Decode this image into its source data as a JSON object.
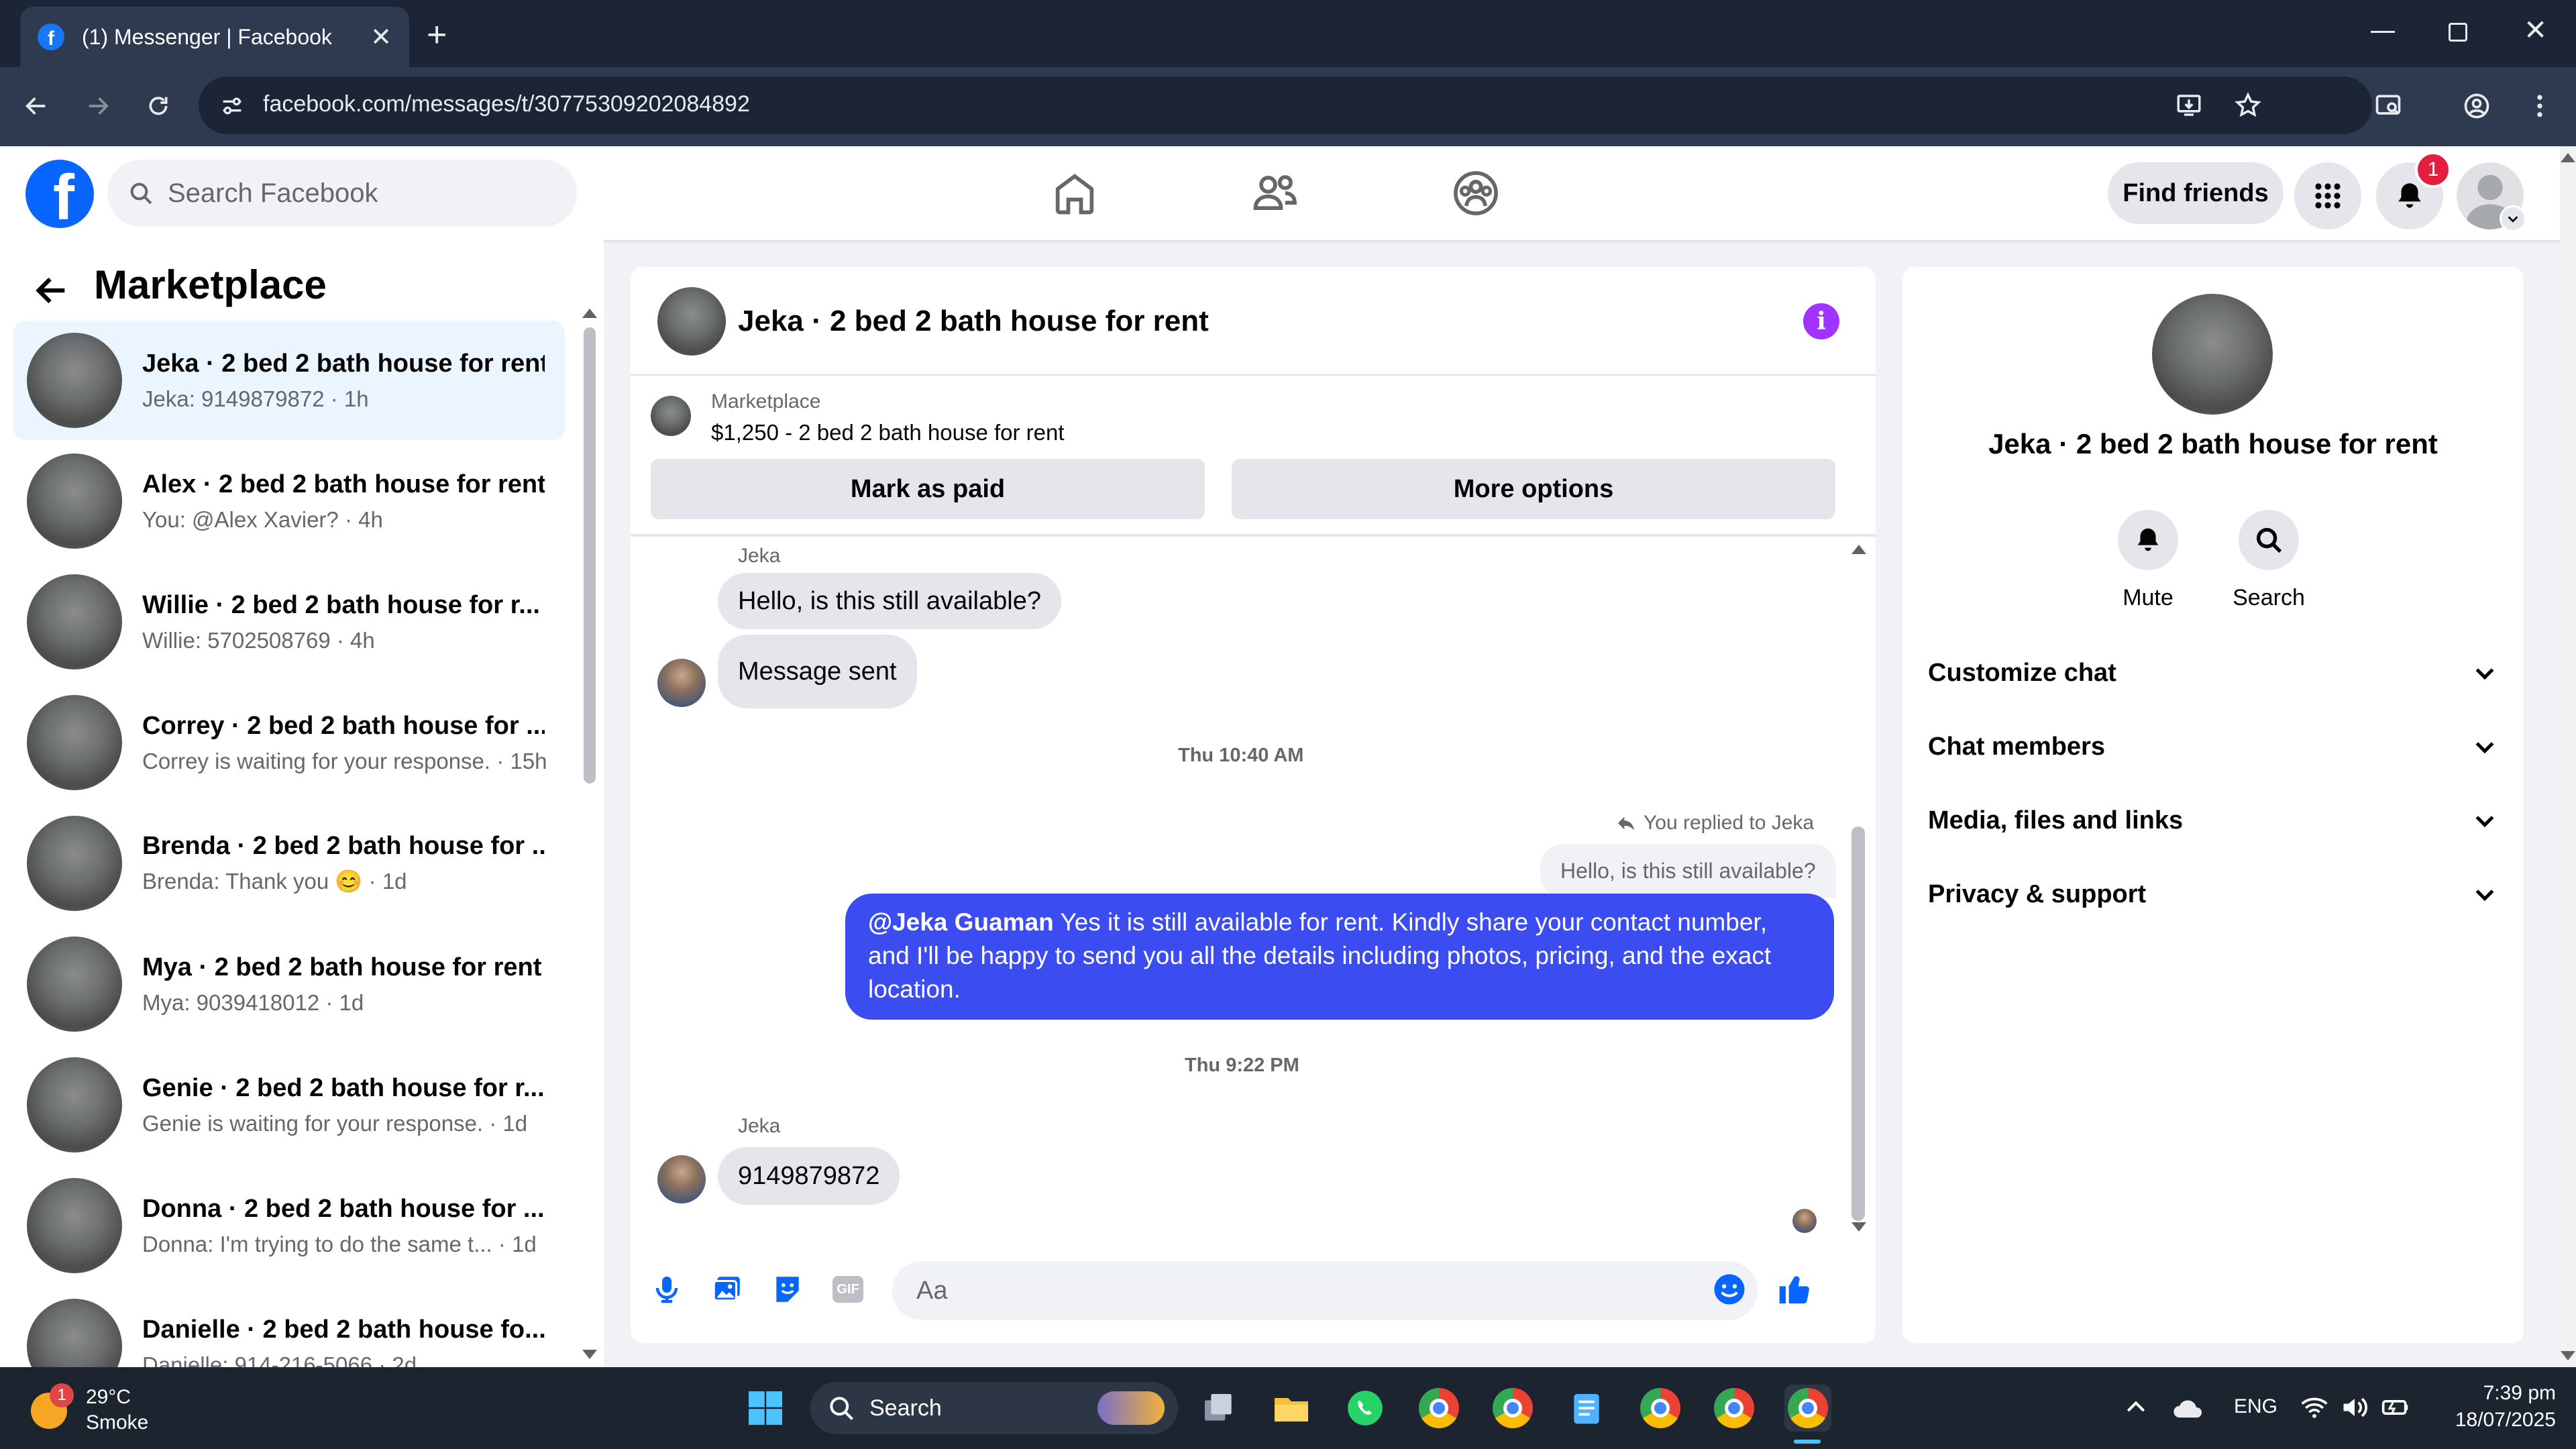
{
  "browser": {
    "tab_title": "(1) Messenger | Facebook",
    "url": "facebook.com/messages/t/30775309202084892"
  },
  "fb": {
    "search_placeholder": "Search Facebook",
    "find_friends": "Find friends",
    "notification_count": "1"
  },
  "left": {
    "title": "Marketplace",
    "conversations": [
      {
        "name": "Jeka · 2 bed 2 bath house for rent",
        "preview": "Jeka: 9149879872 · 1h"
      },
      {
        "name": "Alex · 2 bed 2 bath house for rent",
        "preview": "You: @Alex Xavier? · 4h"
      },
      {
        "name": "Willie · 2 bed 2 bath house for r...",
        "preview": "Willie: 5702508769 · 4h"
      },
      {
        "name": "Correy · 2 bed 2 bath house for ...",
        "preview": "Correy is waiting for your response. · 15h"
      },
      {
        "name": "Brenda · 2 bed 2 bath house for ...",
        "preview": "Brenda: Thank you 😊 · 1d"
      },
      {
        "name": "Mya · 2 bed 2 bath house for rent",
        "preview": "Mya: 9039418012 · 1d"
      },
      {
        "name": "Genie · 2 bed 2 bath house for r...",
        "preview": "Genie is waiting for your response. · 1d"
      },
      {
        "name": "Donna · 2 bed 2 bath house for ...",
        "preview": "Donna: I'm trying to do the same t...  · 1d"
      },
      {
        "name": "Danielle · 2 bed 2 bath house fo...",
        "preview": "Danielle: 914-216-5066 · 2d"
      }
    ]
  },
  "chat": {
    "title": "Jeka · 2 bed 2 bath house for rent",
    "listing_source": "Marketplace",
    "listing_title": "$1,250 - 2 bed 2 bath house for rent",
    "mark_paid": "Mark as paid",
    "more_options": "More options",
    "sender1": "Jeka",
    "msg1": "Hello, is this still available?",
    "msg2": "Message sent",
    "ts1": "Thu 10:40 AM",
    "replied_to": "You replied to Jeka",
    "quoted": "Hello, is this still available?",
    "mention": "@Jeka Guaman",
    "reply_text": " Yes it is still available for rent. Kindly share your contact number, and I'll be happy to send you all the details including photos, pricing, and the exact location.",
    "ts2": "Thu 9:22 PM",
    "sender2": "Jeka",
    "msg3": "9149879872",
    "composer_placeholder": "Aa"
  },
  "right": {
    "title": "Jeka · 2 bed 2 bath house for rent",
    "mute": "Mute",
    "search": "Search",
    "sections": [
      "Customize chat",
      "Chat members",
      "Media, files and links",
      "Privacy & support"
    ]
  },
  "taskbar": {
    "weather_temp": "29°C",
    "weather_desc": "Smoke",
    "weather_badge": "1",
    "search": "Search",
    "lang": "ENG",
    "time": "7:39 pm",
    "date": "18/07/2025"
  },
  "colors": {
    "fb_blue": "#0866ff",
    "own_bubble": "#3b4cf0",
    "info_purple": "#a033ff"
  }
}
